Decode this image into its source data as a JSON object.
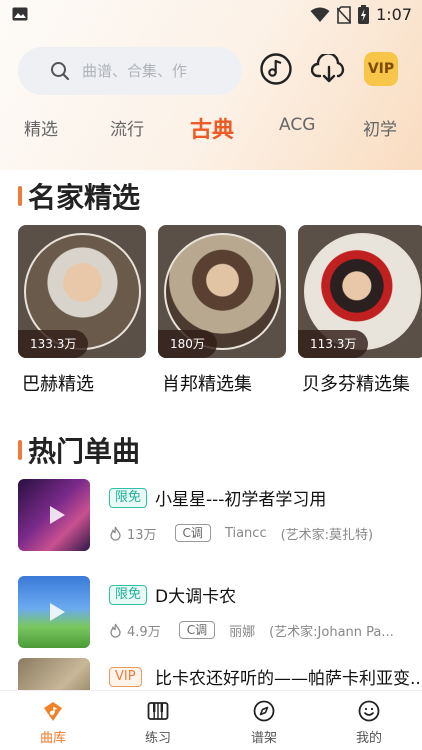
{
  "status": {
    "time": "1:07"
  },
  "search": {
    "placeholder": "曲谱、合集、作"
  },
  "header": {
    "vip_label": "VIP"
  },
  "tabs": [
    "精选",
    "流行",
    "古典",
    "ACG",
    "初学"
  ],
  "active_tab": "古典",
  "section_masters": {
    "title": "名家精选",
    "cards": [
      {
        "count": "133.3万",
        "label": "巴赫精选"
      },
      {
        "count": "180万",
        "label": "肖邦精选集"
      },
      {
        "count": "113.3万",
        "label": "贝多芬精选集"
      }
    ]
  },
  "section_songs": {
    "title": "热门单曲",
    "items": [
      {
        "tag": "限免",
        "title": "小星星---初学者学习用",
        "plays": "13万",
        "key": "C调",
        "author": "Tiancc",
        "artist": "(艺术家:莫扎特)"
      },
      {
        "tag": "限免",
        "title": "D大调卡农",
        "plays": "4.9万",
        "key": "C调",
        "author": "丽娜",
        "artist": "(艺术家:Johann Pa..."
      },
      {
        "tag": "VIP",
        "title": "比卡农还好听的——帕萨卡利亚变...",
        "plays": "",
        "key": "",
        "author": "",
        "artist": ""
      }
    ]
  },
  "bottom_nav": [
    {
      "label": "曲库",
      "icon": "library-icon"
    },
    {
      "label": "练习",
      "icon": "piano-icon"
    },
    {
      "label": "谱架",
      "icon": "compass-icon"
    },
    {
      "label": "我的",
      "icon": "profile-icon"
    }
  ],
  "colors": {
    "accent": "#ee5a24",
    "free_tag": "#2fc2a6",
    "vip_gold": "#f7c548"
  }
}
